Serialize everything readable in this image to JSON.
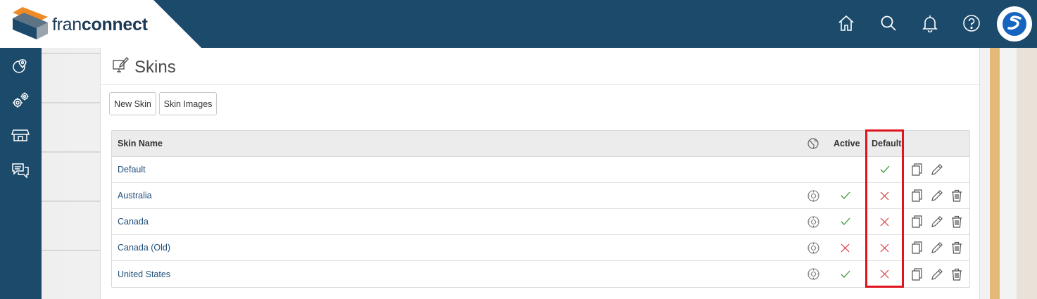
{
  "app": {
    "brand_light": "fran",
    "brand_bold": "connect"
  },
  "header_icons": [
    "home-icon",
    "search-icon",
    "bell-icon",
    "help-icon",
    "user-avatar"
  ],
  "rail_icons": [
    "map-pin-icon",
    "gears-icon",
    "storefront-icon",
    "chat-icon"
  ],
  "page": {
    "title": "Skins"
  },
  "toolbar": {
    "new_skin": "New Skin",
    "skin_images": "Skin Images"
  },
  "table": {
    "columns": {
      "name": "Skin Name",
      "active": "Active",
      "default": "Default"
    },
    "rows": [
      {
        "name": "Default",
        "has_target": false,
        "active": "",
        "default": "yes",
        "can_delete": false
      },
      {
        "name": "Australia",
        "has_target": true,
        "active": "yes",
        "default": "no",
        "can_delete": true
      },
      {
        "name": "Canada",
        "has_target": true,
        "active": "yes",
        "default": "no",
        "can_delete": true
      },
      {
        "name": "Canada (Old)",
        "has_target": true,
        "active": "no",
        "default": "no",
        "can_delete": true
      },
      {
        "name": "United States",
        "has_target": true,
        "active": "yes",
        "default": "no",
        "can_delete": true
      }
    ]
  },
  "colors": {
    "brand_navy": "#1b4a6b",
    "check_green": "#3a9a3a",
    "cross_red": "#d23a3a",
    "highlight_red": "#e0141e",
    "logo_orange": "#f08a24"
  }
}
